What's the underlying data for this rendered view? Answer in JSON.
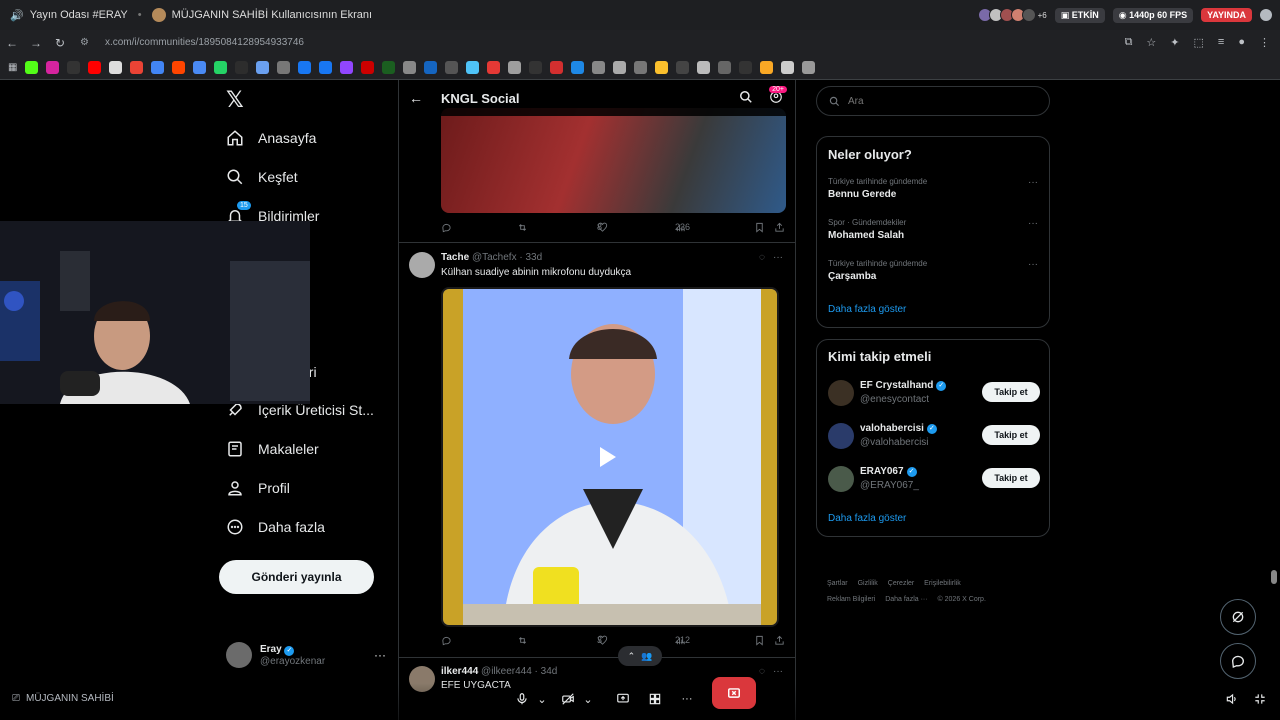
{
  "discord": {
    "room": "Yayın Odası #ERAY",
    "sep": "•",
    "viewer_title": "MÜJGANIN SAHİBİ Kullanıcısının Ekranı",
    "viewer_extra": "+6",
    "status": "ETKİN",
    "quality": "1440p 60 FPS",
    "live": "YAYINDA",
    "streamer_label": "MÜJGANIN SAHİBİ"
  },
  "browser": {
    "url": "x.com/i/communities/1895084128954933746"
  },
  "nav": {
    "logo": "𝕏",
    "items": [
      {
        "label": "Anasayfa",
        "icon": "home-icon"
      },
      {
        "label": "Keşfet",
        "icon": "search-icon"
      },
      {
        "label": "Bildirimler",
        "icon": "bell-icon",
        "badge": "15"
      },
      {
        "label": "tleri",
        "icon": "list-icon"
      },
      {
        "label": "İçerik Üreticisi St...",
        "icon": "rocket-icon"
      },
      {
        "label": "Makaleler",
        "icon": "article-icon"
      },
      {
        "label": "Profil",
        "icon": "person-icon"
      },
      {
        "label": "Daha fazla",
        "icon": "more-circle-icon"
      }
    ],
    "post_button": "Gönderi yayınla",
    "account": {
      "name": "Eray",
      "handle": "@erayozkenar",
      "more": "···"
    }
  },
  "community": {
    "title": "KNGL Social",
    "member_count": "20+",
    "tweet1": {
      "reply": "",
      "retweet": "",
      "likes": "8",
      "views": "236"
    },
    "tweet2": {
      "name": "Tache",
      "handle": "@Tachefx · 33d",
      "text": "Külhan suadiye abinin mikrofonu duydukça",
      "likes": "3",
      "views": "212"
    },
    "tweet3": {
      "name": "ilker444",
      "handle": "@ilkeer444 · 34d",
      "text": "EFE UYGACTA"
    }
  },
  "sidebar": {
    "search_placeholder": "Ara",
    "trends_title": "Neler oluyor?",
    "trends": [
      {
        "context": "Türkiye tarihinde gündemde",
        "title": "Bennu Gerede"
      },
      {
        "context": "Spor · Gündemdekiler",
        "title": "Mohamed Salah"
      },
      {
        "context": "Türkiye tarihinde gündemde",
        "title": "Çarşamba"
      }
    ],
    "trends_more": "Daha fazla göster",
    "who_title": "Kimi takip etmeli",
    "who": [
      {
        "name": "EF Crystalhand",
        "handle": "@enesycontact",
        "button": "Takip et"
      },
      {
        "name": "valohabercisi",
        "handle": "@valohabercisi",
        "button": "Takip et"
      },
      {
        "name": "ERAY067",
        "handle": "@ERAY067_",
        "button": "Takip et"
      }
    ],
    "who_more": "Daha fazla göster",
    "footer": [
      "Şartlar",
      "Gizlilik",
      "Çerezler",
      "Erişilebilirlik",
      "Reklam Bilgileri",
      "Daha fazla ···",
      "© 2026 X Corp."
    ]
  },
  "colors": {
    "accent": "#1d9bf0",
    "leave": "#da373c",
    "pink": "#f91880"
  }
}
